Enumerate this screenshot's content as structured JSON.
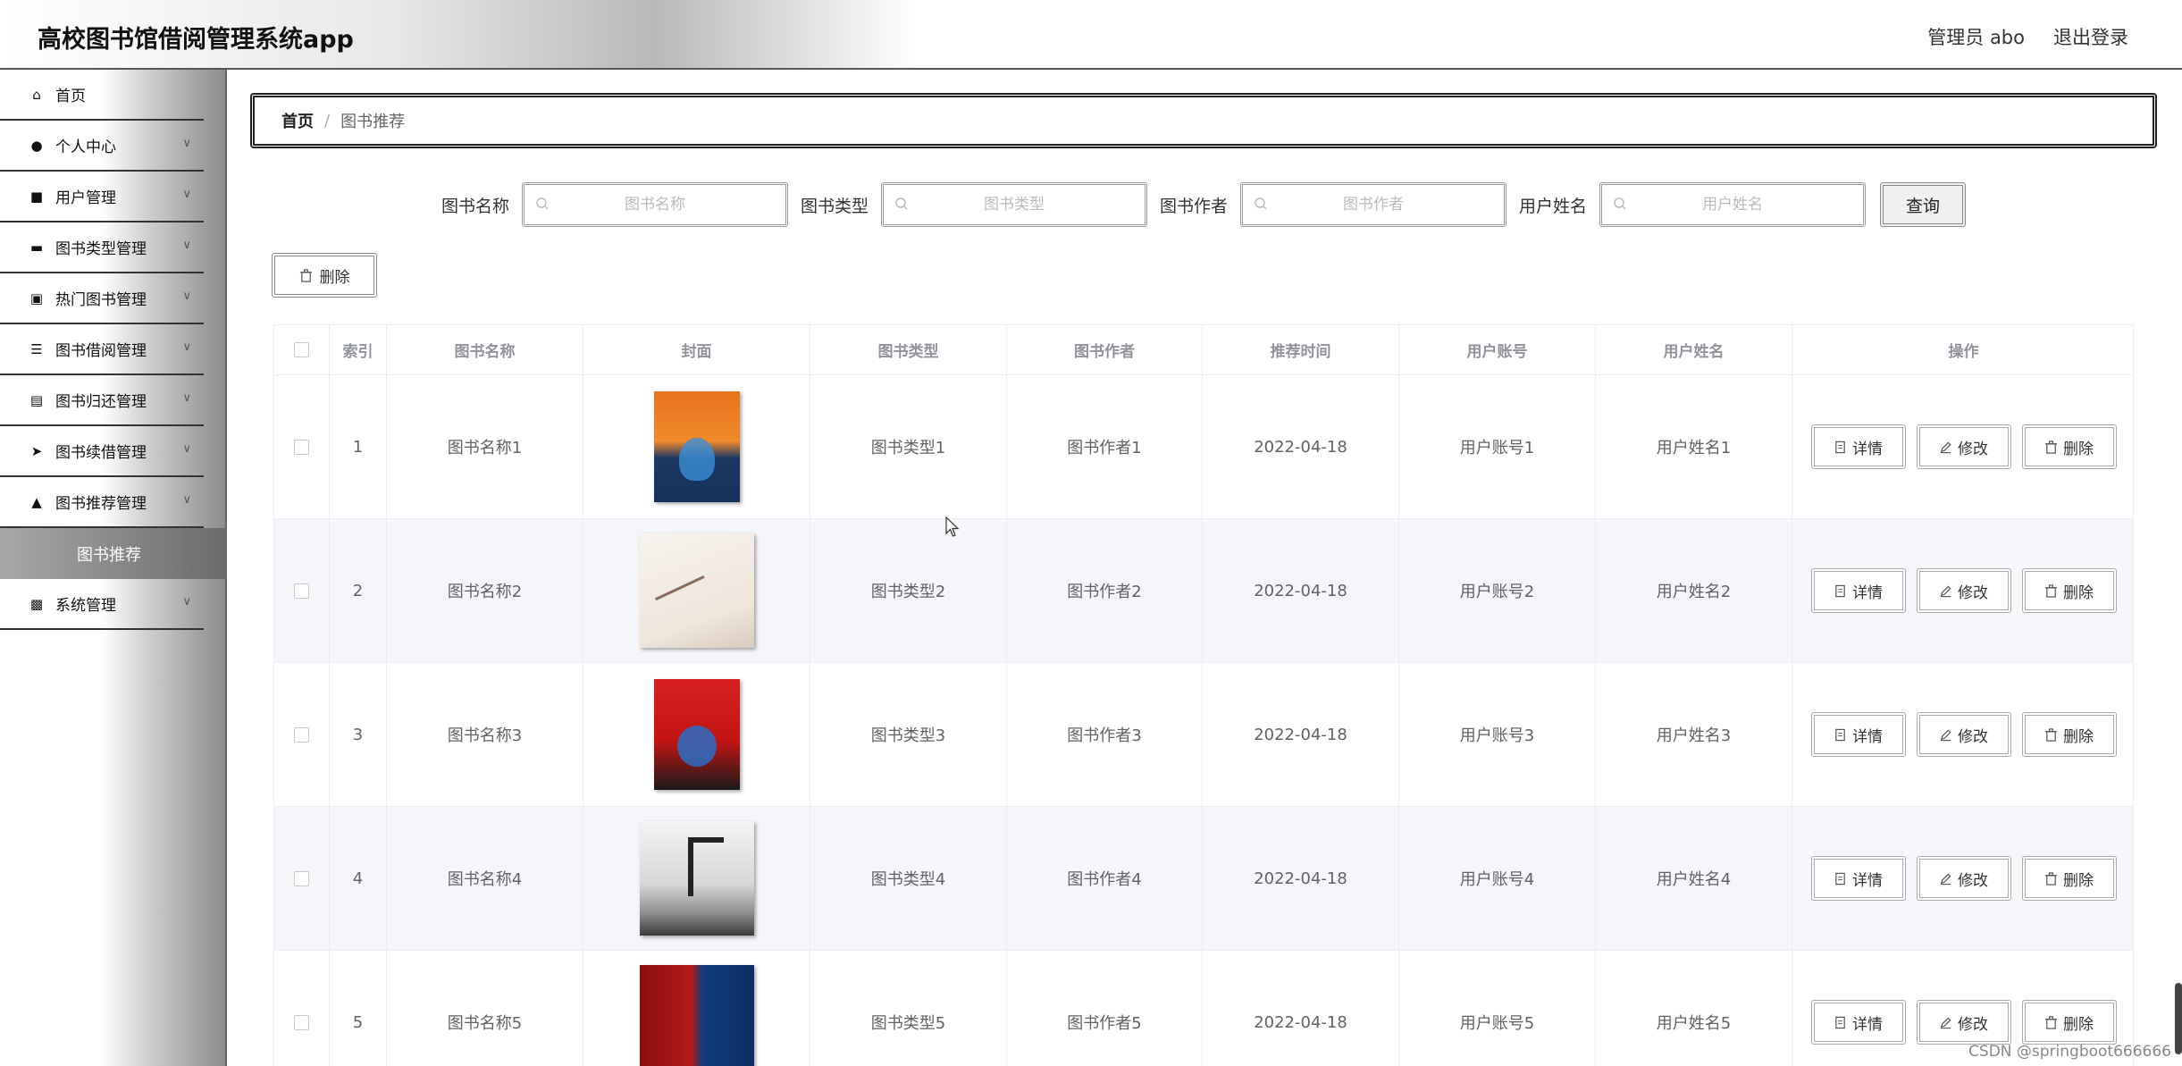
{
  "header": {
    "title": "高校图书馆借阅管理系统app",
    "admin": "管理员 abo",
    "logout": "退出登录"
  },
  "sidebar": {
    "items": [
      {
        "label": "首页",
        "icon": "home-icon"
      },
      {
        "label": "个人中心",
        "icon": "person-icon"
      },
      {
        "label": "用户管理",
        "icon": "briefcase-icon"
      },
      {
        "label": "图书类型管理",
        "icon": "monitor-icon"
      },
      {
        "label": "热门图书管理",
        "icon": "clipboard-check-icon"
      },
      {
        "label": "图书借阅管理",
        "icon": "sliders-icon"
      },
      {
        "label": "图书归还管理",
        "icon": "clipboard-icon"
      },
      {
        "label": "图书续借管理",
        "icon": "paper-plane-icon"
      },
      {
        "label": "图书推荐管理",
        "icon": "user-upload-icon"
      },
      {
        "label": "系统管理",
        "icon": "clipboard-x-icon"
      }
    ],
    "active_sub": "图书推荐"
  },
  "breadcrumb": {
    "home": "首页",
    "separator": "/",
    "current": "图书推荐"
  },
  "search": {
    "fields": [
      {
        "label": "图书名称",
        "placeholder": "图书名称",
        "value": ""
      },
      {
        "label": "图书类型",
        "placeholder": "图书类型",
        "value": ""
      },
      {
        "label": "图书作者",
        "placeholder": "图书作者",
        "value": ""
      },
      {
        "label": "用户姓名",
        "placeholder": "用户姓名",
        "value": ""
      }
    ],
    "query_label": "查询"
  },
  "toolbar": {
    "delete_label": "删除"
  },
  "table": {
    "columns": [
      "索引",
      "图书名称",
      "封面",
      "图书类型",
      "图书作者",
      "推荐时间",
      "用户账号",
      "用户姓名",
      "操作"
    ],
    "rows": [
      {
        "index": "1",
        "name": "图书名称1",
        "type": "图书类型1",
        "author": "图书作者1",
        "time": "2022-04-18",
        "account": "用户账号1",
        "username": "用户姓名1"
      },
      {
        "index": "2",
        "name": "图书名称2",
        "type": "图书类型2",
        "author": "图书作者2",
        "time": "2022-04-18",
        "account": "用户账号2",
        "username": "用户姓名2"
      },
      {
        "index": "3",
        "name": "图书名称3",
        "type": "图书类型3",
        "author": "图书作者3",
        "time": "2022-04-18",
        "account": "用户账号3",
        "username": "用户姓名3"
      },
      {
        "index": "4",
        "name": "图书名称4",
        "type": "图书类型4",
        "author": "图书作者4",
        "time": "2022-04-18",
        "account": "用户账号4",
        "username": "用户姓名4"
      },
      {
        "index": "5",
        "name": "图书名称5",
        "type": "图书类型5",
        "author": "图书作者5",
        "time": "2022-04-18",
        "account": "用户账号5",
        "username": "用户姓名5"
      }
    ],
    "actions": {
      "detail": "详情",
      "edit": "修改",
      "delete": "删除"
    }
  },
  "watermark": "CSDN @springboot666666"
}
